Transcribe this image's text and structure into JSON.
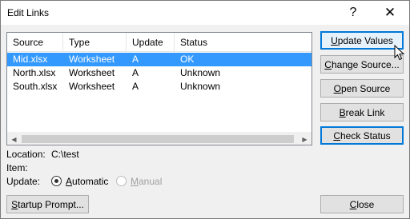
{
  "window": {
    "title": "Edit Links",
    "help_glyph": "?",
    "close_glyph": "✕"
  },
  "table": {
    "columns": [
      "Source",
      "Type",
      "Update",
      "Status"
    ],
    "rows": [
      {
        "source": "Mid.xlsx",
        "type": "Worksheet",
        "update": "A",
        "status": "OK",
        "selected": true
      },
      {
        "source": "North.xlsx",
        "type": "Worksheet",
        "update": "A",
        "status": "Unknown",
        "selected": false
      },
      {
        "source": "South.xlsx",
        "type": "Worksheet",
        "update": "A",
        "status": "Unknown",
        "selected": false
      }
    ]
  },
  "buttons": {
    "update_values": {
      "prefix": "",
      "accel": "U",
      "rest": "pdate Values"
    },
    "change_source": {
      "prefix": "",
      "accel": "C",
      "rest": "hange Source..."
    },
    "open_source": {
      "prefix": "",
      "accel": "O",
      "rest": "pen Source"
    },
    "break_link": {
      "prefix": "",
      "accel": "B",
      "rest": "reak Link"
    },
    "check_status": {
      "prefix": "",
      "accel": "C",
      "rest": "heck Status"
    },
    "startup_prompt": {
      "prefix": "",
      "accel": "S",
      "rest": "tartup Prompt..."
    },
    "close": {
      "prefix": "",
      "accel": "C",
      "rest": "lose"
    }
  },
  "info": {
    "location_label": "Location:",
    "location_value": "C:\\test",
    "item_label": "Item:",
    "item_value": "",
    "update_label": "Update:"
  },
  "update_mode": {
    "automatic": {
      "accel": "A",
      "rest": "utomatic",
      "checked": true
    },
    "manual": {
      "accel": "M",
      "rest": "anual",
      "disabled": true
    }
  }
}
